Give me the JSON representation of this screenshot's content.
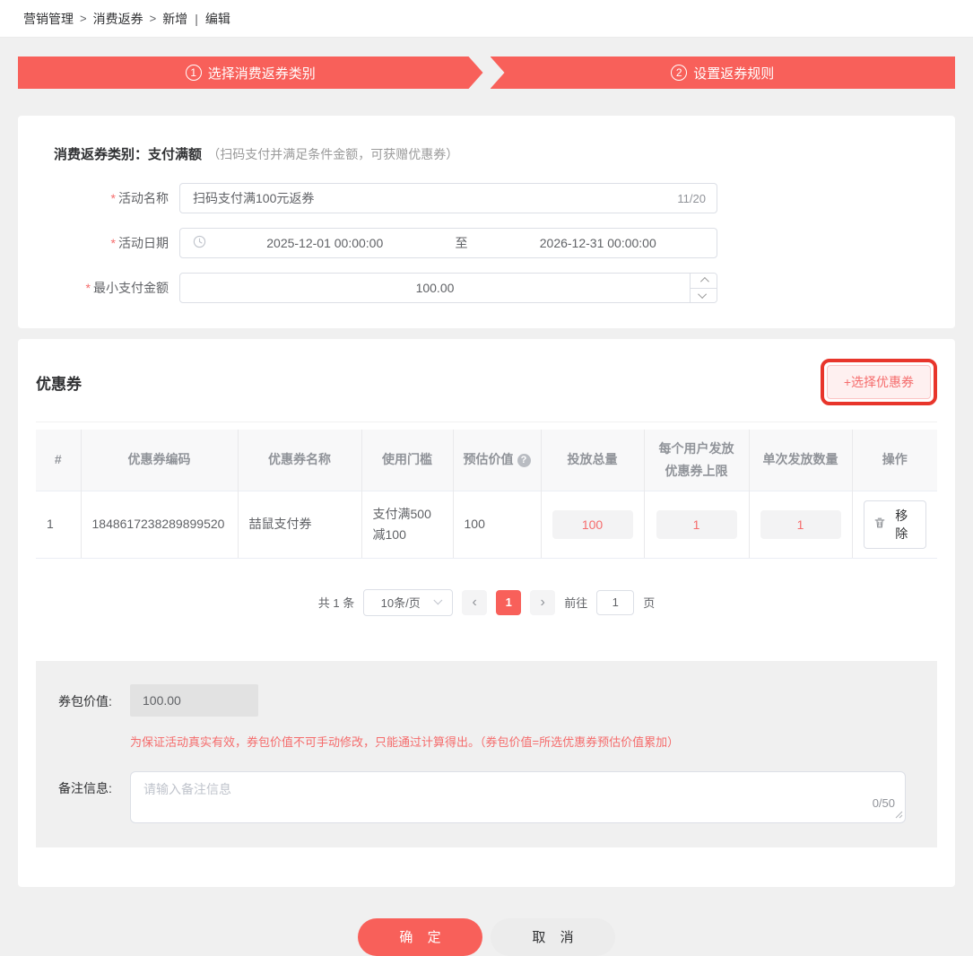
{
  "colors": {
    "primary": "#f8605a",
    "danger_text": "#f56c6c",
    "annotation_ring": "#e8352b"
  },
  "breadcrumb": {
    "items": [
      "营销管理",
      "消费返券",
      "新增"
    ],
    "separator": ">",
    "divider": "|",
    "current": "编辑"
  },
  "steps": [
    {
      "number": "1",
      "label": "选择消费返券类别"
    },
    {
      "number": "2",
      "label": "设置返券规则"
    }
  ],
  "category": {
    "label": "消费返券类别：",
    "value": "支付满额",
    "hint": "（扫码支付并满足条件金额，可获赠优惠券）"
  },
  "form": {
    "required_mark": "*",
    "activity_name": {
      "label": "活动名称",
      "value": "扫码支付满100元返券",
      "counter": "11/20"
    },
    "activity_date": {
      "label": "活动日期",
      "start": "2025-12-01 00:00:00",
      "separator": "至",
      "end": "2026-12-31 00:00:00"
    },
    "min_pay": {
      "label": "最小支付金额",
      "value": "100.00"
    }
  },
  "coupon": {
    "title": "优惠券",
    "select_button": "+选择优惠券",
    "table": {
      "headers": [
        "#",
        "优惠券编码",
        "优惠券名称",
        "使用门槛",
        "预估价值",
        "投放总量",
        "每个用户发放优惠券上限",
        "单次发放数量",
        "操作"
      ],
      "row": {
        "index": "1",
        "code": "1848617238289899520",
        "name": "喆鼠支付券",
        "threshold": "支付满500减100",
        "estimated_value": "100",
        "total_quantity": "100",
        "per_user_limit": "1",
        "per_issue_quantity": "1",
        "remove_label": "移除"
      }
    },
    "pagination": {
      "total": "共 1 条",
      "page_size": "10条/页",
      "prev": "‹",
      "page": "1",
      "next": "›",
      "goto_label": "前往",
      "goto_value": "1",
      "goto_unit": "页"
    }
  },
  "package": {
    "value_label": "券包价值:",
    "value": "100.00",
    "hint": "为保证活动真实有效，券包价值不可手动修改，只能通过计算得出。（券包价值=所选优惠券预估价值累加）",
    "remark_label": "备注信息:",
    "remark_placeholder": "请输入备注信息",
    "remark_counter": "0/50"
  },
  "footer": {
    "confirm": "确 定",
    "cancel": "取 消"
  },
  "icons": {
    "help_glyph": "?",
    "clock": "clock-icon",
    "trash": "trash-icon"
  }
}
